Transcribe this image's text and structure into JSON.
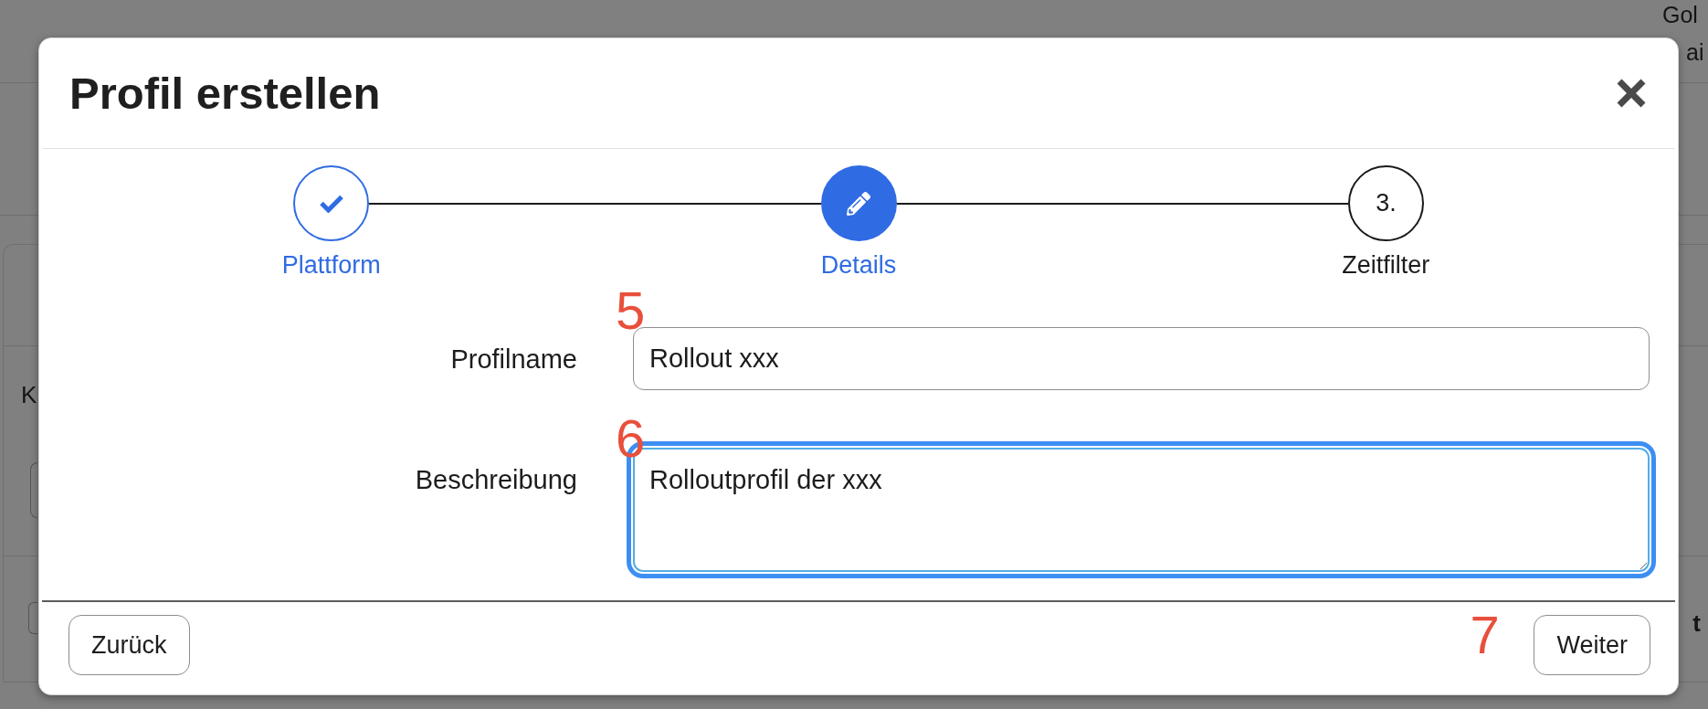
{
  "background_page": {
    "top_right_lines": [
      "Gol",
      "ai"
    ],
    "left_label": "K",
    "right_label": "t"
  },
  "dialog": {
    "title": "Profil erstellen",
    "steps": [
      {
        "label": "Plattform",
        "completed": true,
        "selected": false
      },
      {
        "label": "Details",
        "completed": false,
        "selected": true
      },
      {
        "label": "Zeitfilter",
        "completed": false,
        "selected": false,
        "number": "3."
      }
    ],
    "fields": [
      {
        "kind": "input",
        "label": "Profilname",
        "value": "Rollout xxx",
        "focused": false,
        "annotation": "5"
      },
      {
        "kind": "textarea",
        "label": "Beschreibung",
        "value": "Rolloutprofil der xxx",
        "focused": true,
        "annotation": "6"
      }
    ],
    "buttons": [
      {
        "label": "Zurück"
      },
      {
        "label": "Weiter",
        "annotation": "7"
      }
    ]
  }
}
